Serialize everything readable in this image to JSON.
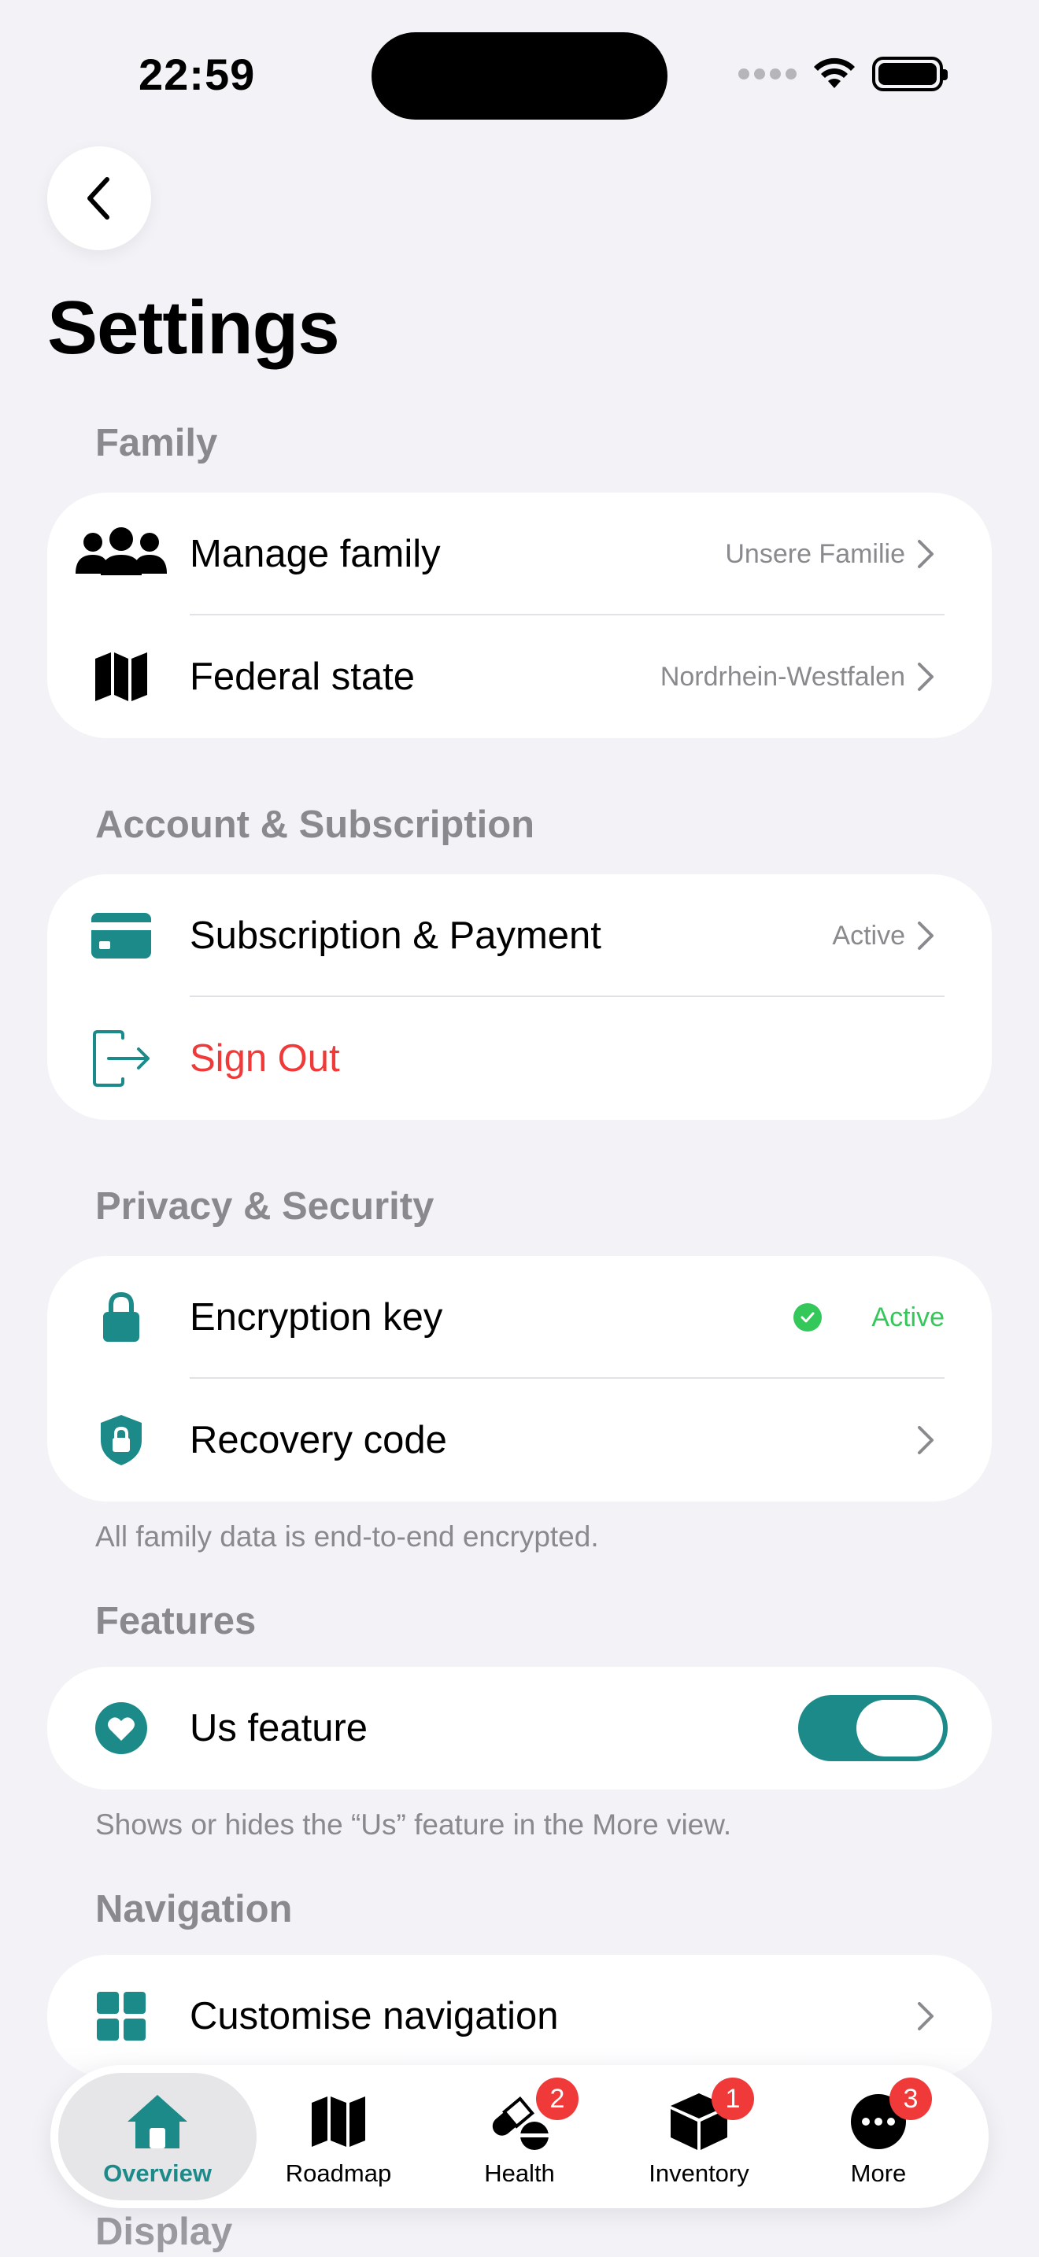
{
  "status": {
    "time": "22:59"
  },
  "page": {
    "title": "Settings"
  },
  "sections": {
    "family": {
      "header": "Family",
      "manage_family": {
        "label": "Manage family",
        "value": "Unsere Familie"
      },
      "federal_state": {
        "label": "Federal state",
        "value": "Nordrhein-Westfalen"
      }
    },
    "account": {
      "header": "Account & Subscription",
      "subscription": {
        "label": "Subscription & Payment",
        "value": "Active"
      },
      "sign_out": {
        "label": "Sign Out"
      }
    },
    "privacy": {
      "header": "Privacy & Security",
      "encryption": {
        "label": "Encryption key",
        "value": "Active"
      },
      "recovery": {
        "label": "Recovery code"
      },
      "footnote": "All family data is end-to-end encrypted."
    },
    "features": {
      "header": "Features",
      "us_feature": {
        "label": "Us feature",
        "enabled": true
      },
      "footnote": "Shows or hides the “Us” feature in the More view."
    },
    "navigation": {
      "header": "Navigation",
      "customise": {
        "label": "Customise navigation"
      }
    },
    "display": {
      "header": "Display"
    }
  },
  "tabbar": {
    "tabs": [
      {
        "label": "Overview",
        "icon": "house-icon",
        "active": true,
        "badge": ""
      },
      {
        "label": "Roadmap",
        "icon": "map-icon",
        "active": false,
        "badge": ""
      },
      {
        "label": "Health",
        "icon": "pills-icon",
        "active": false,
        "badge": "2"
      },
      {
        "label": "Inventory",
        "icon": "box-icon",
        "active": false,
        "badge": "1"
      },
      {
        "label": "More",
        "icon": "ellipsis-icon",
        "active": false,
        "badge": "3"
      }
    ]
  },
  "colors": {
    "accent": "#1d8a8a",
    "danger": "#f03a3a",
    "success": "#34c759",
    "secondary_text": "#8a8a8e",
    "background": "#f2f2f7"
  }
}
